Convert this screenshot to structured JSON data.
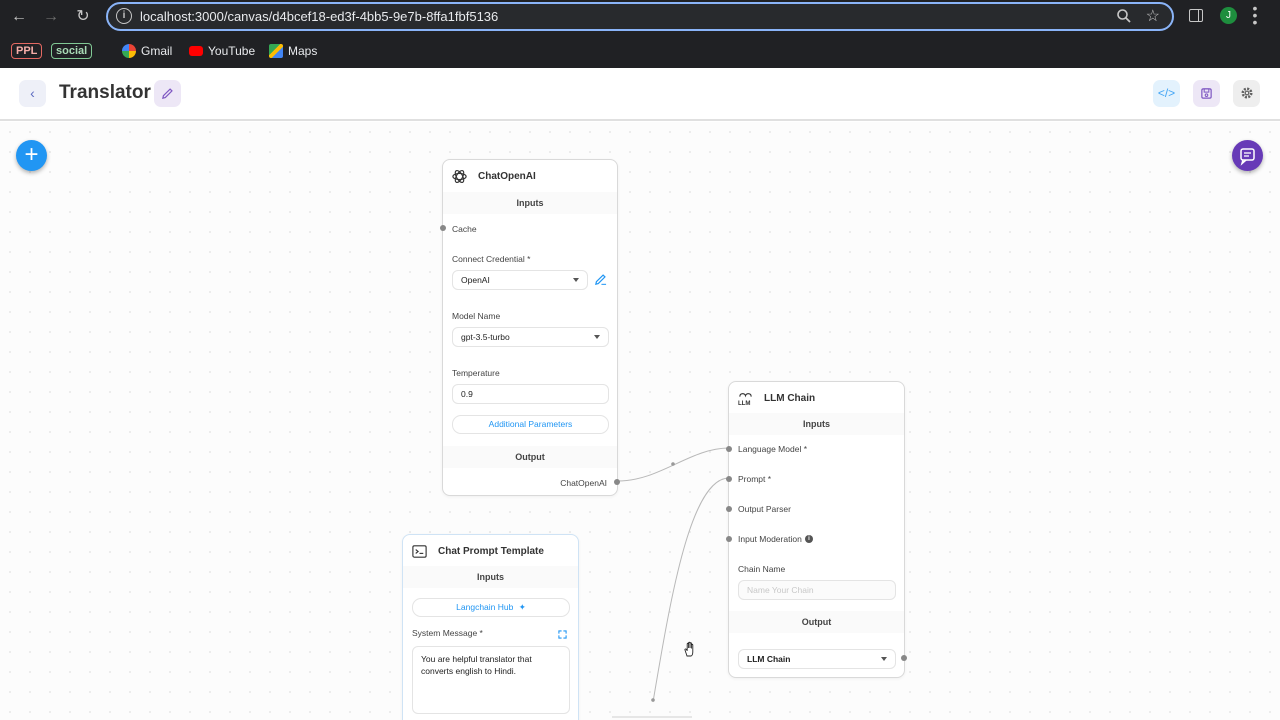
{
  "browser": {
    "url": "localhost:3000/canvas/d4bcef18-ed3f-4bb5-9e7b-8ffa1fbf5136",
    "profile_initial": "J",
    "bookmarks": {
      "ppl": "PPL",
      "social": "social",
      "gmail": "Gmail",
      "youtube": "YouTube",
      "maps": "Maps"
    }
  },
  "header": {
    "title": "Translator"
  },
  "nodes": {
    "chat_openai": {
      "title": "ChatOpenAI",
      "inputs_label": "Inputs",
      "cache_label": "Cache",
      "credential_label": "Connect Credential *",
      "credential_value": "OpenAI",
      "model_label": "Model Name",
      "model_value": "gpt-3.5-turbo",
      "temperature_label": "Temperature",
      "temperature_value": "0.9",
      "additional_params": "Additional Parameters",
      "output_label": "Output",
      "output_name": "ChatOpenAI"
    },
    "llm_chain": {
      "title": "LLM Chain",
      "inputs_label": "Inputs",
      "language_model": "Language Model *",
      "prompt": "Prompt *",
      "output_parser": "Output Parser",
      "input_moderation": "Input Moderation",
      "chain_name_label": "Chain Name",
      "chain_name_placeholder": "Name Your Chain",
      "output_label": "Output",
      "output_value": "LLM Chain"
    },
    "chat_prompt": {
      "title": "Chat Prompt Template",
      "inputs_label": "Inputs",
      "langchain_hub": "Langchain Hub",
      "system_message_label": "System Message *",
      "system_message_value": "You are helpful translator that converts english to Hindi."
    }
  },
  "colors": {
    "accent_blue": "#2196f3",
    "accent_purple": "#673ab7",
    "url_focus": "#8ab4f8"
  }
}
